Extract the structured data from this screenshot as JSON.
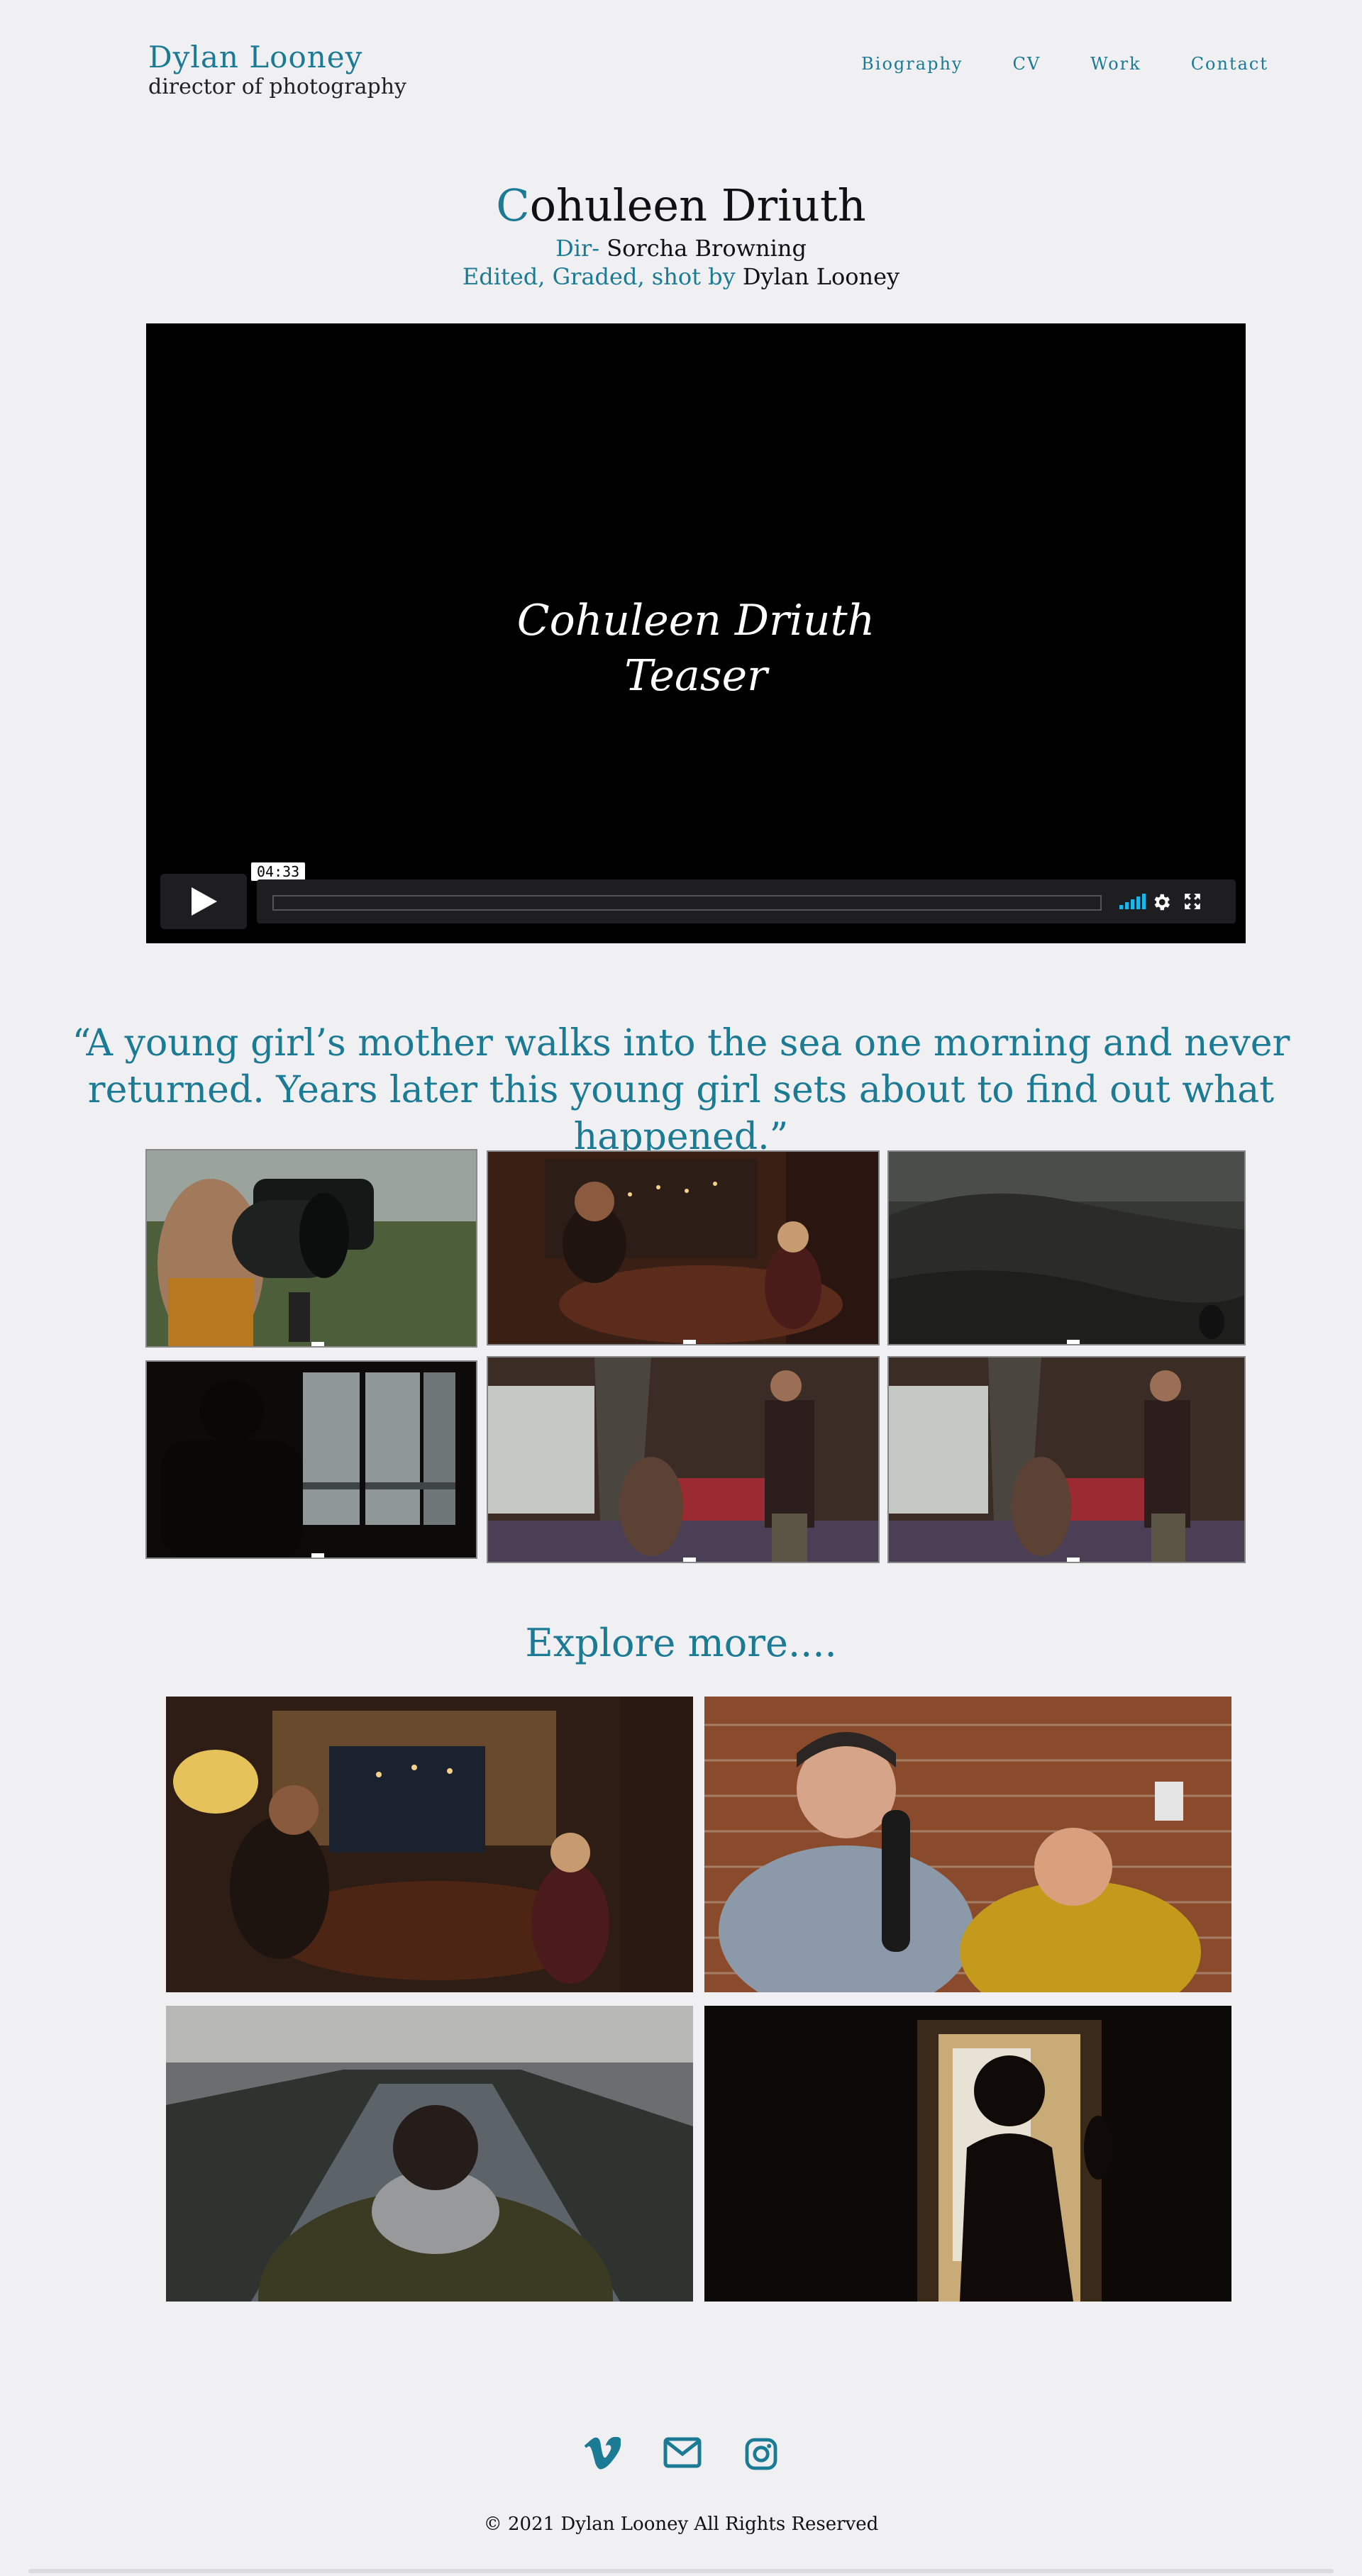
{
  "header": {
    "name": "Dylan Looney",
    "role": "director of photography",
    "nav": [
      "Biography",
      "CV",
      "Work",
      "Contact"
    ]
  },
  "project": {
    "title_first": "C",
    "title_rest": "ohuleen Driuth",
    "dir_label": "Dir-",
    "dir_name": "Sorcha Browning",
    "edit_label": "Edited, Graded, shot by",
    "edit_name": "Dylan Looney"
  },
  "video": {
    "title_line1": "Cohuleen Driuth",
    "title_line2": "Teaser",
    "duration": "04:33",
    "progress": 0,
    "accent": "#1ab7ea"
  },
  "quote": {
    "line1": "“A young girl’s mother walks into the sea one morning and never",
    "line2": "returned. Years later this young girl sets about to find out what happened.”"
  },
  "explore": {
    "heading": "Explore more...."
  },
  "footer": {
    "icons": [
      "vimeo-icon",
      "mail-icon",
      "instagram-icon"
    ],
    "copyright": "© 2021 Dylan Looney All Rights Reserved"
  },
  "colors": {
    "accent": "#1b7a94",
    "background": "#f0eff2"
  }
}
